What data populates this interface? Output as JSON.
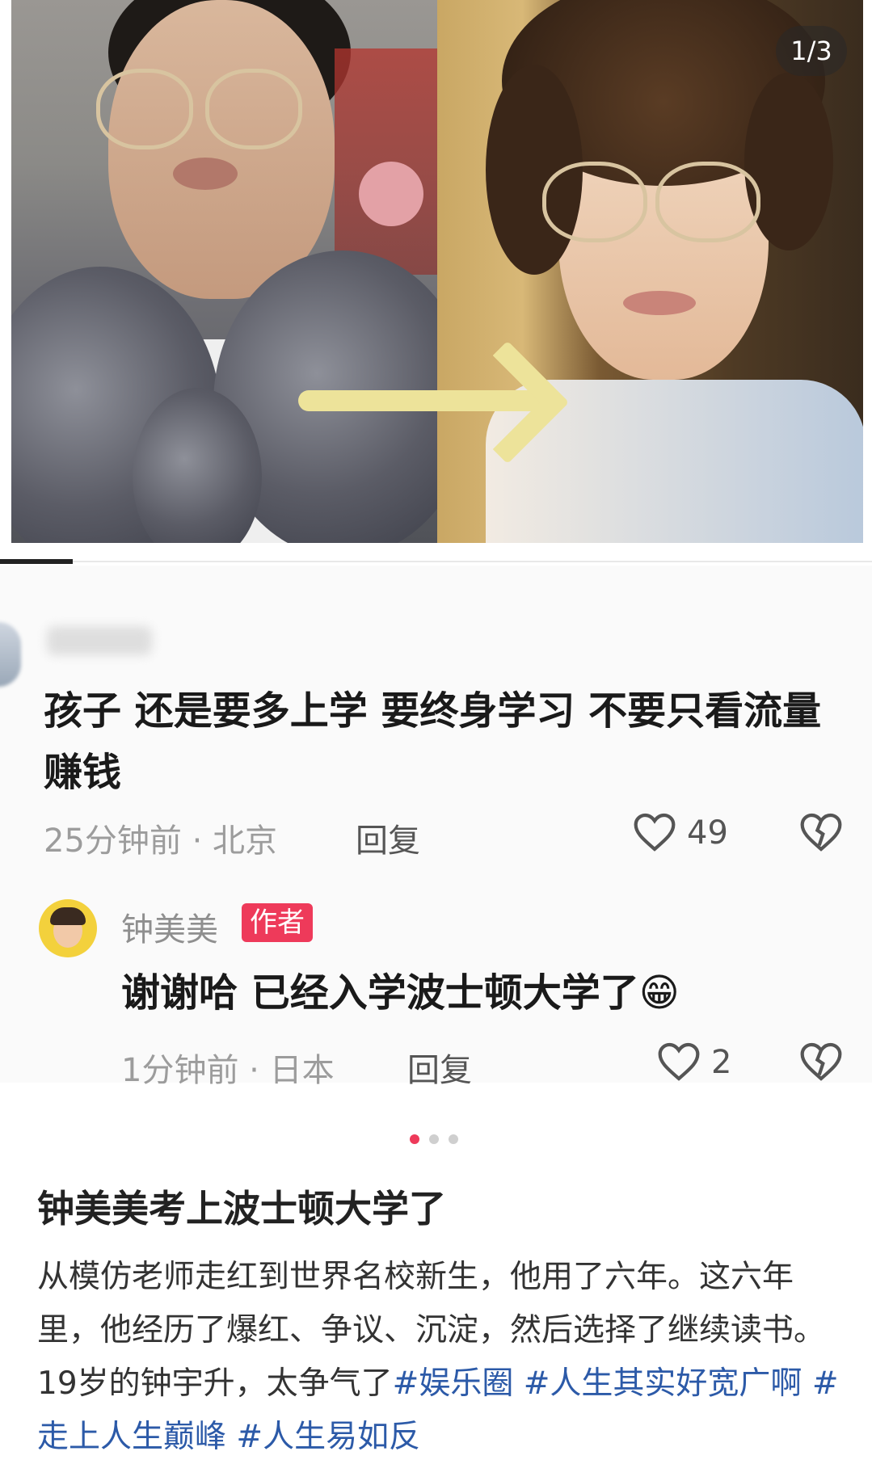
{
  "carousel": {
    "counter": "1/3",
    "page_dots": [
      true,
      false,
      false
    ],
    "accent_color": "#ee3a5a"
  },
  "comment": {
    "text": "孩子 还是要多上学 要终身学习 不要只看流量赚钱",
    "time_location": "25分钟前 · 北京",
    "reply_label": "回复",
    "likes": "49"
  },
  "author_reply": {
    "name": "钟美美",
    "badge": "作者",
    "text": "谢谢哈 已经入学波士顿大学了",
    "emoji": "😁",
    "time_location": "1分钟前 · 日本",
    "reply_label": "回复",
    "likes": "2"
  },
  "post": {
    "title": "钟美美考上波士顿大学了",
    "body": "从模仿老师走红到世界名校新生，他用了六年。这六年里，他经历了爆红、争议、沉淀，然后选择了继续读书。19岁的钟宇升，太争气了",
    "hashtags": [
      "#娱乐圈",
      "#人生其实好宽广啊",
      "#走上人生巅峰",
      "#人生易如反"
    ]
  }
}
